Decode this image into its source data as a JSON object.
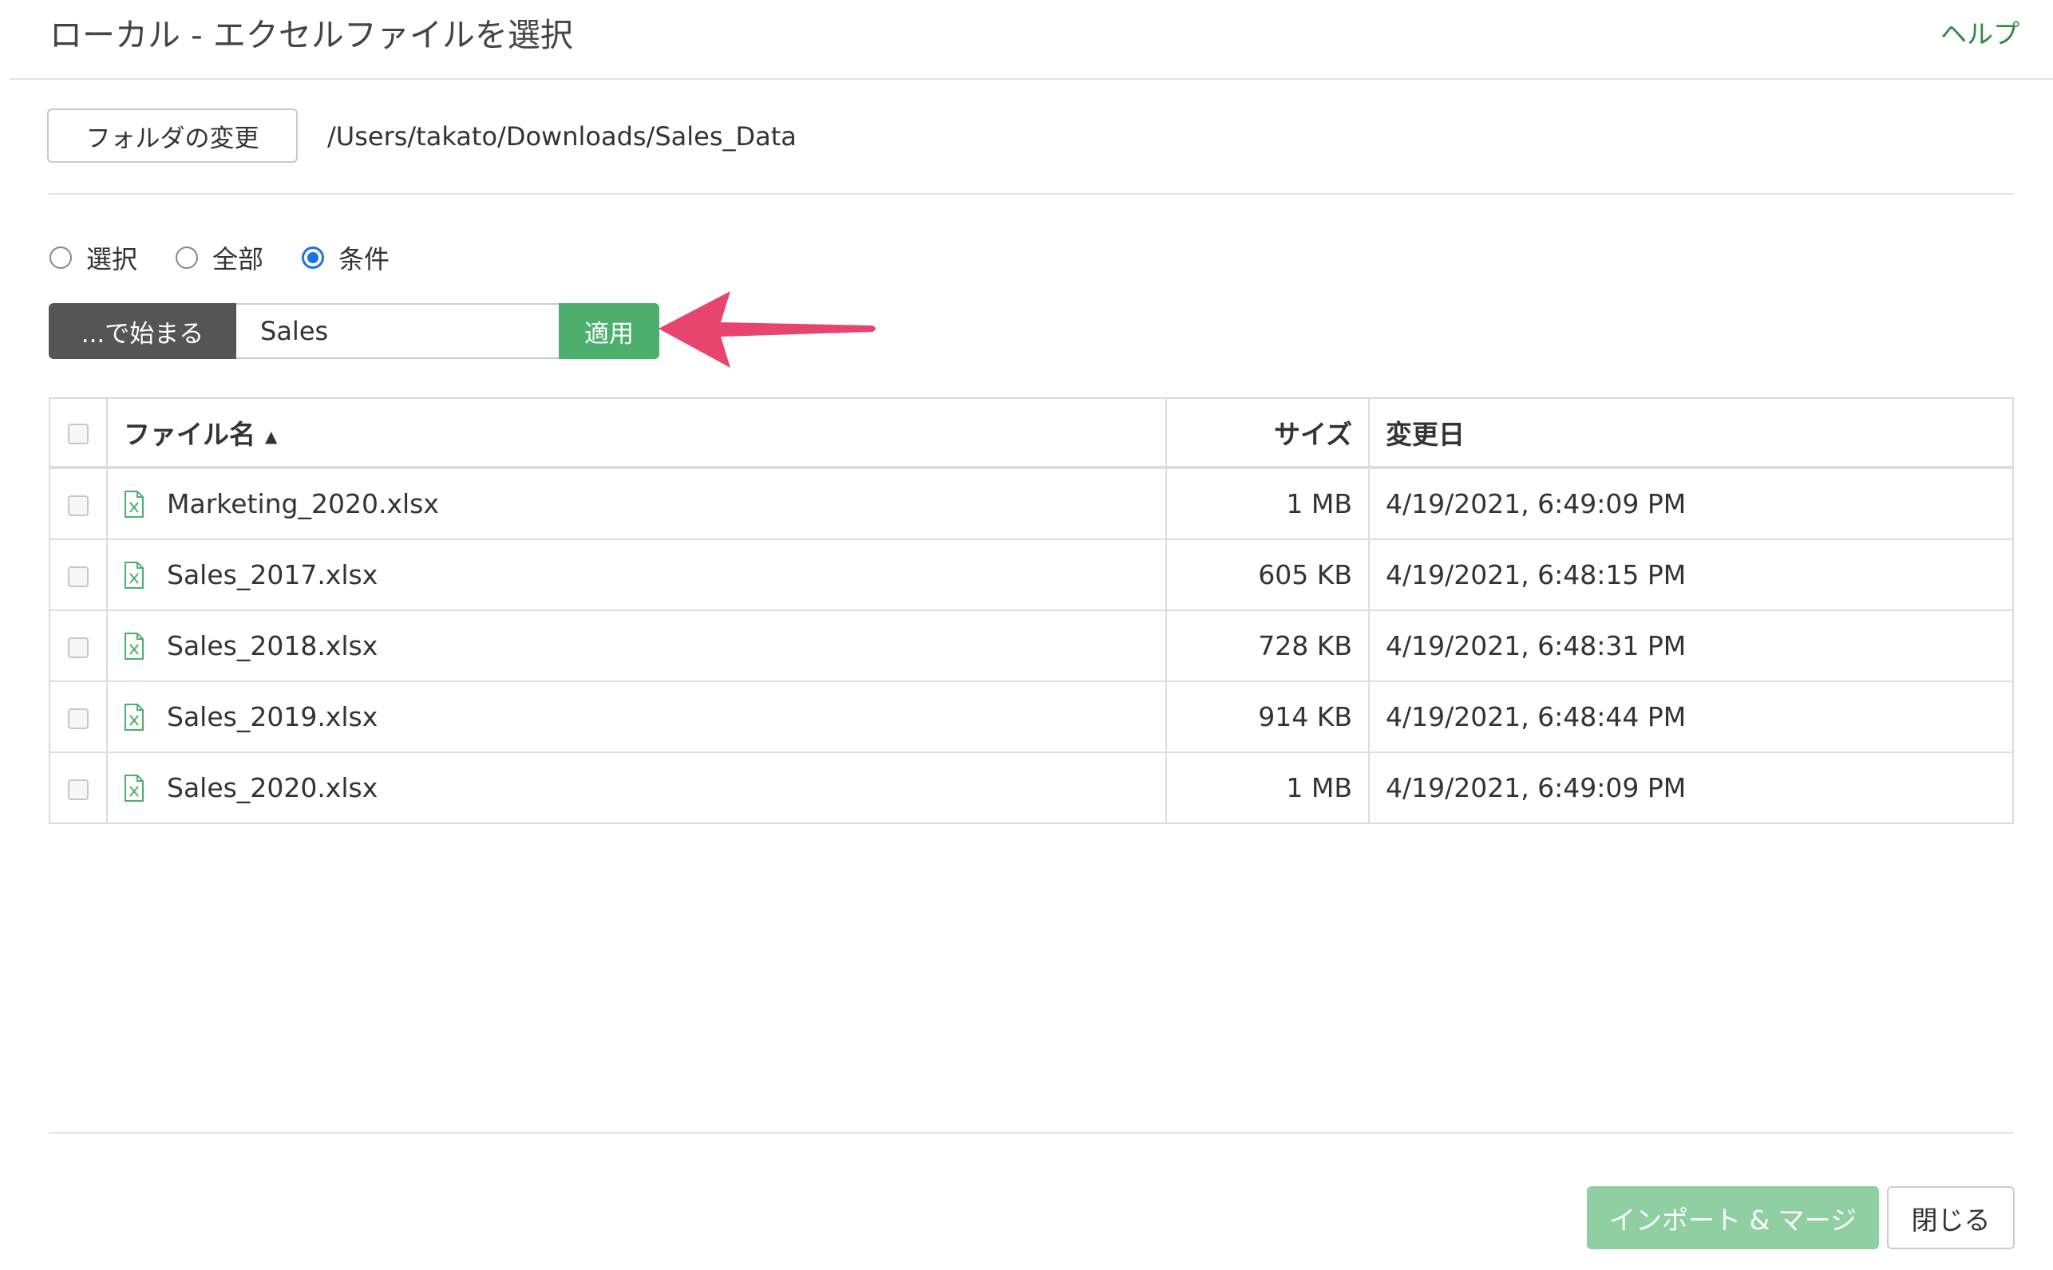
{
  "dialog": {
    "title": "ローカル - エクセルファイルを選択",
    "help_label": "ヘルプ"
  },
  "folder": {
    "change_label": "フォルダの変更",
    "path": "/Users/takato/Downloads/Sales_Data"
  },
  "selection_mode": {
    "options": [
      "選択",
      "全部",
      "条件"
    ],
    "selected": "条件"
  },
  "filter": {
    "operator_label": "...で始まる",
    "value": "Sales",
    "apply_label": "適用"
  },
  "table": {
    "headers": {
      "name": "ファイル名",
      "size": "サイズ",
      "modified": "変更日"
    },
    "sort": {
      "column": "name",
      "direction": "ascending"
    },
    "rows": [
      {
        "name": "Marketing_2020.xlsx",
        "size": "1 MB",
        "modified": "4/19/2021, 6:49:09 PM",
        "icon": "excel-file-icon"
      },
      {
        "name": "Sales_2017.xlsx",
        "size": "605 KB",
        "modified": "4/19/2021, 6:48:15 PM",
        "icon": "excel-file-icon"
      },
      {
        "name": "Sales_2018.xlsx",
        "size": "728 KB",
        "modified": "4/19/2021, 6:48:31 PM",
        "icon": "excel-file-icon"
      },
      {
        "name": "Sales_2019.xlsx",
        "size": "914 KB",
        "modified": "4/19/2021, 6:48:44 PM",
        "icon": "excel-file-icon"
      },
      {
        "name": "Sales_2020.xlsx",
        "size": "1 MB",
        "modified": "4/19/2021, 6:49:09 PM",
        "icon": "excel-file-icon"
      }
    ]
  },
  "footer": {
    "import_label": "インポート & マージ",
    "close_label": "閉じる"
  },
  "colors": {
    "accent_green": "#4caf6e",
    "help_link": "#2e8b3e",
    "annotation_arrow": "#e8456e",
    "radio_selected": "#1a73e8"
  }
}
